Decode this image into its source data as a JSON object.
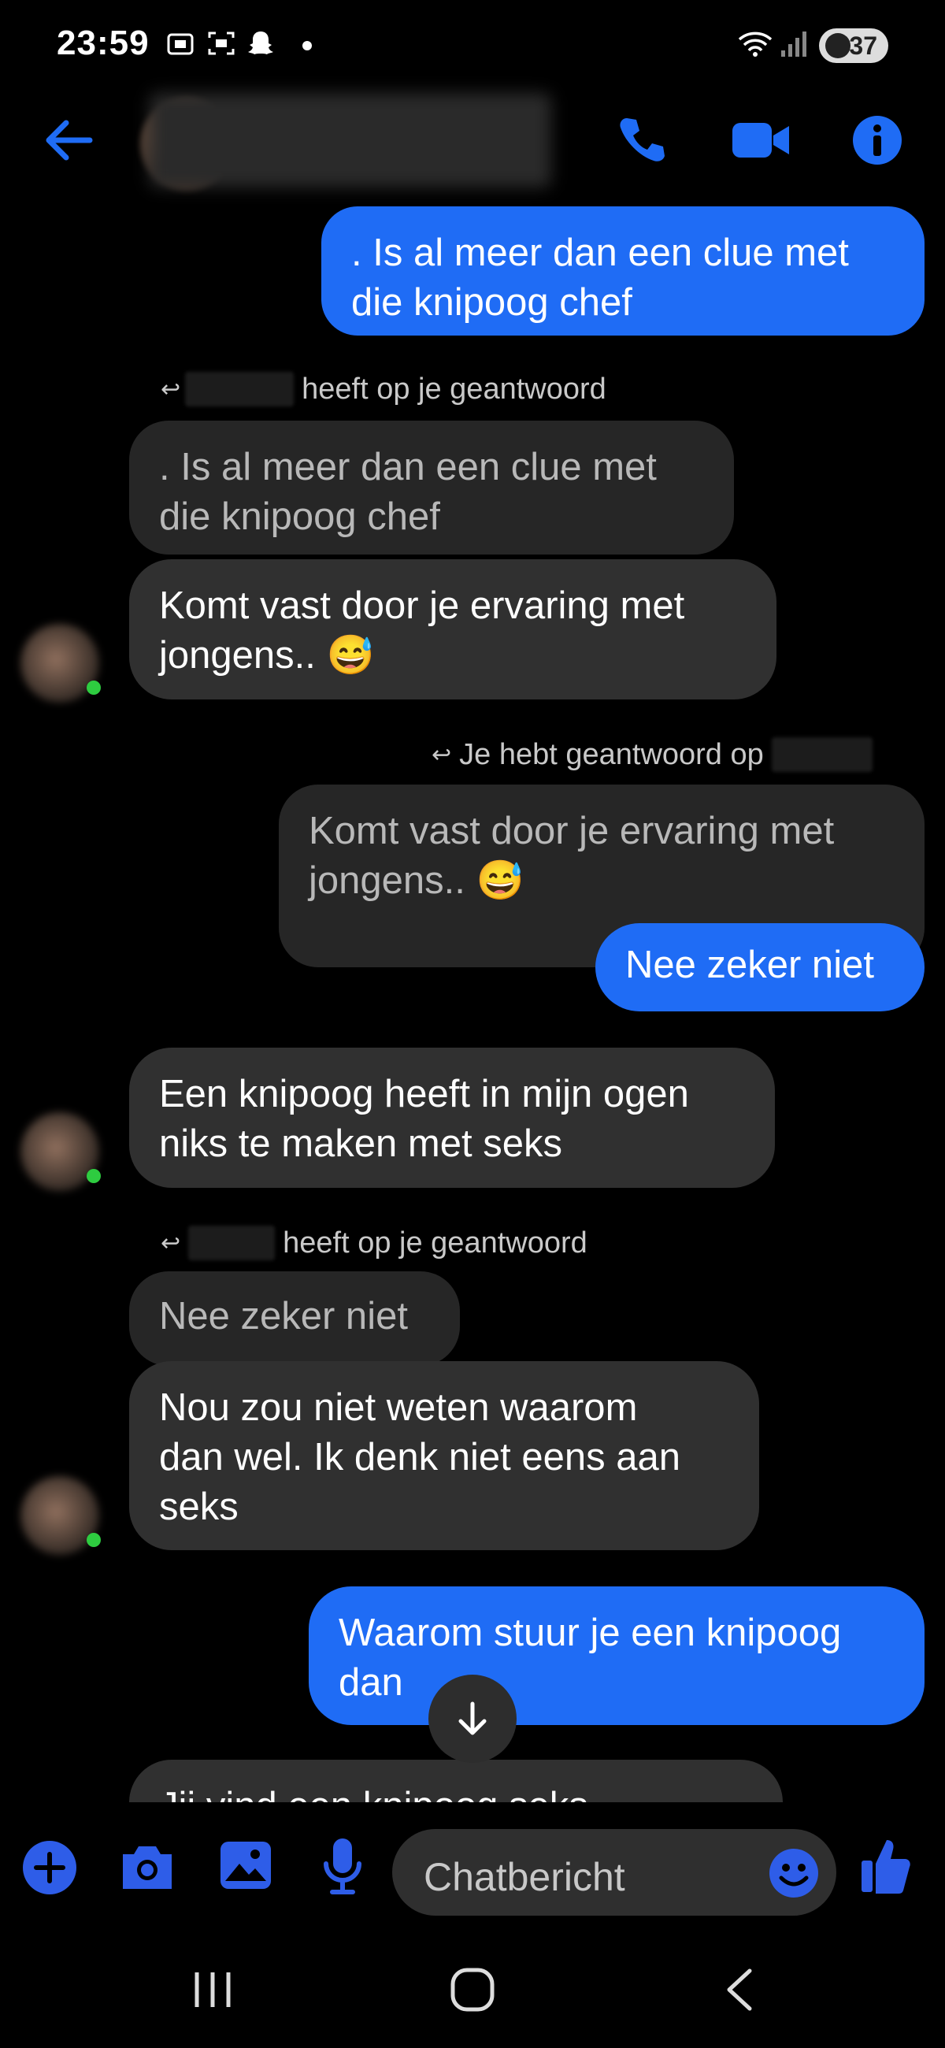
{
  "status_bar": {
    "time": "23:59",
    "battery": "37"
  },
  "header": {
    "icons": [
      "back-arrow-icon",
      "phone-icon",
      "video-camera-icon",
      "info-icon"
    ]
  },
  "messages": {
    "m1": {
      "text_line1": ". Is al meer dan een clue met",
      "text_line2": "die knipoog chef"
    },
    "reply1": {
      "label": "heeft op je geantwoord"
    },
    "q1": {
      "text_line1": ". Is al meer dan een clue met",
      "text_line2": "die knipoog chef"
    },
    "m2": {
      "text_line1": "Komt vast door je ervaring met",
      "text_line2": "jongens.. 😅"
    },
    "reply2": {
      "label": "Je hebt geantwoord op"
    },
    "q2": {
      "text_line1": "Komt vast door je ervaring met",
      "text_line2": "jongens.. 😅"
    },
    "m3": {
      "text": "Nee zeker niet"
    },
    "m4": {
      "text_line1": "Een knipoog heeft in mijn ogen",
      "text_line2": "niks te maken met seks"
    },
    "reply3": {
      "label": "heeft op je geantwoord"
    },
    "q3": {
      "text": "Nee zeker niet"
    },
    "m5": {
      "text_line1": "Nou zou niet weten waarom",
      "text_line2": "dan wel. Ik denk niet eens aan",
      "text_line3": "seks"
    },
    "m6": {
      "text_line1": "Waarom stuur je een knipoog",
      "text_line2": "dan"
    },
    "m7": {
      "text": "Jij vind een knipoog seks"
    }
  },
  "composer": {
    "placeholder": "Chatbericht"
  },
  "colors": {
    "accent": "#1f6cf5",
    "icon_blue": "#1f6cf5",
    "incoming": "#303030",
    "quoted": "#262626",
    "online": "#2ecc40"
  }
}
